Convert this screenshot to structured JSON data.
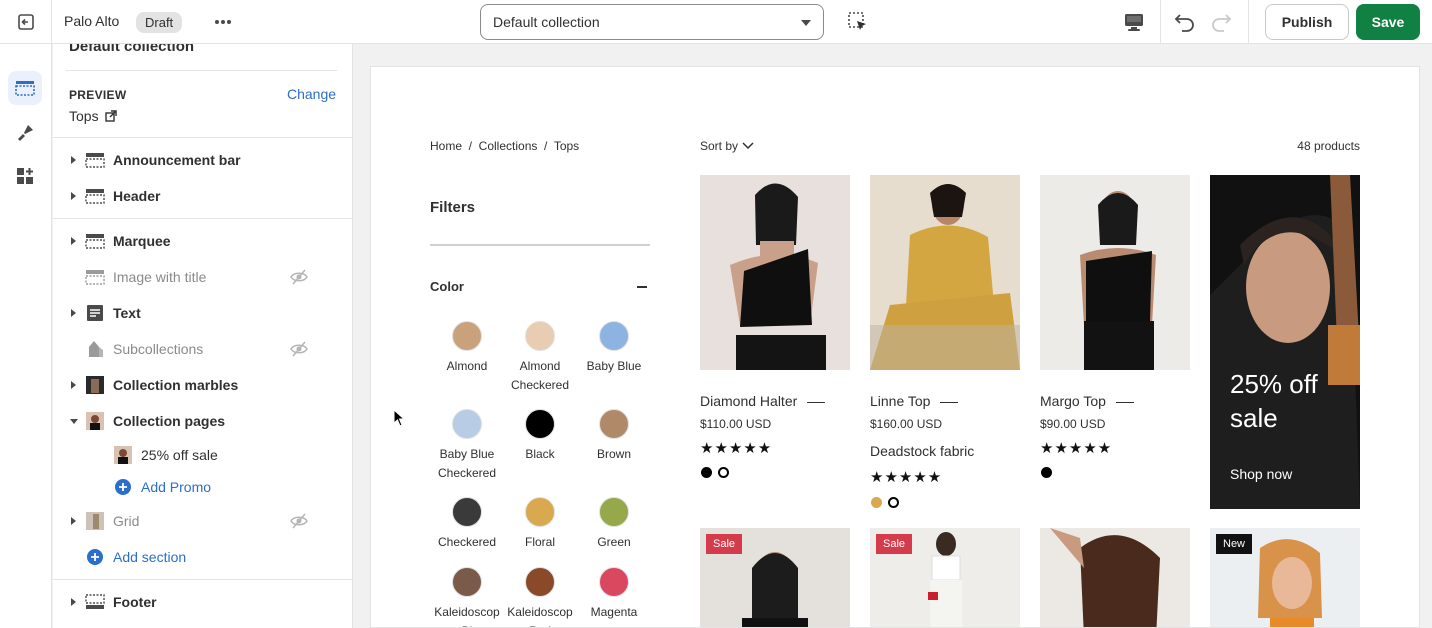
{
  "topbar": {
    "store_name": "Palo Alto",
    "status_badge": "Draft",
    "template_select": "Default collection",
    "publish_label": "Publish",
    "save_label": "Save",
    "icons": [
      "exit-icon",
      "more-icon",
      "inspector-icon",
      "desktop-icon",
      "undo-icon",
      "redo-icon"
    ]
  },
  "rail": {
    "items": [
      "sections-icon",
      "theme-settings-icon",
      "apps-icon"
    ]
  },
  "sidebar": {
    "cut_title": "Default collection",
    "preview_label": "PREVIEW",
    "change_label": "Change",
    "preview_value": "Tops",
    "sections": [
      {
        "label": "Announcement bar",
        "state": "collapsed"
      },
      {
        "label": "Header",
        "state": "collapsed"
      },
      {
        "label": "Marquee",
        "state": "collapsed"
      },
      {
        "label": "Image with title",
        "state": "hidden"
      },
      {
        "label": "Text",
        "state": "collapsed"
      },
      {
        "label": "Subcollections",
        "state": "hidden"
      },
      {
        "label": "Collection marbles",
        "state": "collapsed"
      },
      {
        "label": "Collection pages",
        "state": "expanded"
      },
      {
        "label": "25% off sale",
        "state": "child"
      },
      {
        "label": "Add Promo",
        "state": "add"
      },
      {
        "label": "Grid",
        "state": "hidden"
      },
      {
        "label": "Add section",
        "state": "add"
      },
      {
        "label": "Footer",
        "state": "collapsed"
      }
    ]
  },
  "preview": {
    "breadcrumb": "Home  /  Collections  /  Tops",
    "sort_label": "Sort by",
    "product_count": "48 products",
    "filters_title": "Filters",
    "color_heading": "Color",
    "swatches": [
      {
        "name": "Almond",
        "color": "#c9a27b"
      },
      {
        "name": "Almond Checkered",
        "color": "#e8cdb3"
      },
      {
        "name": "Baby Blue",
        "color": "#8db4e0"
      },
      {
        "name": "Baby Blue Checkered",
        "color": "#b9cce6"
      },
      {
        "name": "Black",
        "color": "#000000"
      },
      {
        "name": "Brown",
        "color": "#b08a68"
      },
      {
        "name": "Checkered",
        "color": "#3a3a3a"
      },
      {
        "name": "Floral",
        "color": "#d9a84f"
      },
      {
        "name": "Green",
        "color": "#95a84a"
      },
      {
        "name": "Kaleidoscop Bl",
        "color": "#7a5a48"
      },
      {
        "name": "Kaleidoscop Red",
        "color": "#8a4a2a"
      },
      {
        "name": "Magenta",
        "color": "#d9485f"
      }
    ],
    "products": [
      {
        "name": "Diamond Halter",
        "price": "$110.00 USD",
        "stars": "★★★★★",
        "bg": "#e8e0dc",
        "colors": [
          "#000000",
          "#ffffff"
        ]
      },
      {
        "name": "Linne Top",
        "price": "$160.00 USD",
        "feature": "Deadstock fabric",
        "stars": "★★★★★",
        "bg": "#d9b66a",
        "colors": [
          "#d9a84f",
          "#ffffff"
        ]
      },
      {
        "name": "Margo Top",
        "price": "$90.00 USD",
        "stars": "★★★★★",
        "bg": "#ecebe8",
        "colors": [
          "#000000"
        ]
      }
    ],
    "promo": {
      "title": "25% off sale",
      "cta": "Shop now"
    },
    "row2_tags": [
      "Sale",
      "Sale",
      "",
      "New"
    ]
  }
}
